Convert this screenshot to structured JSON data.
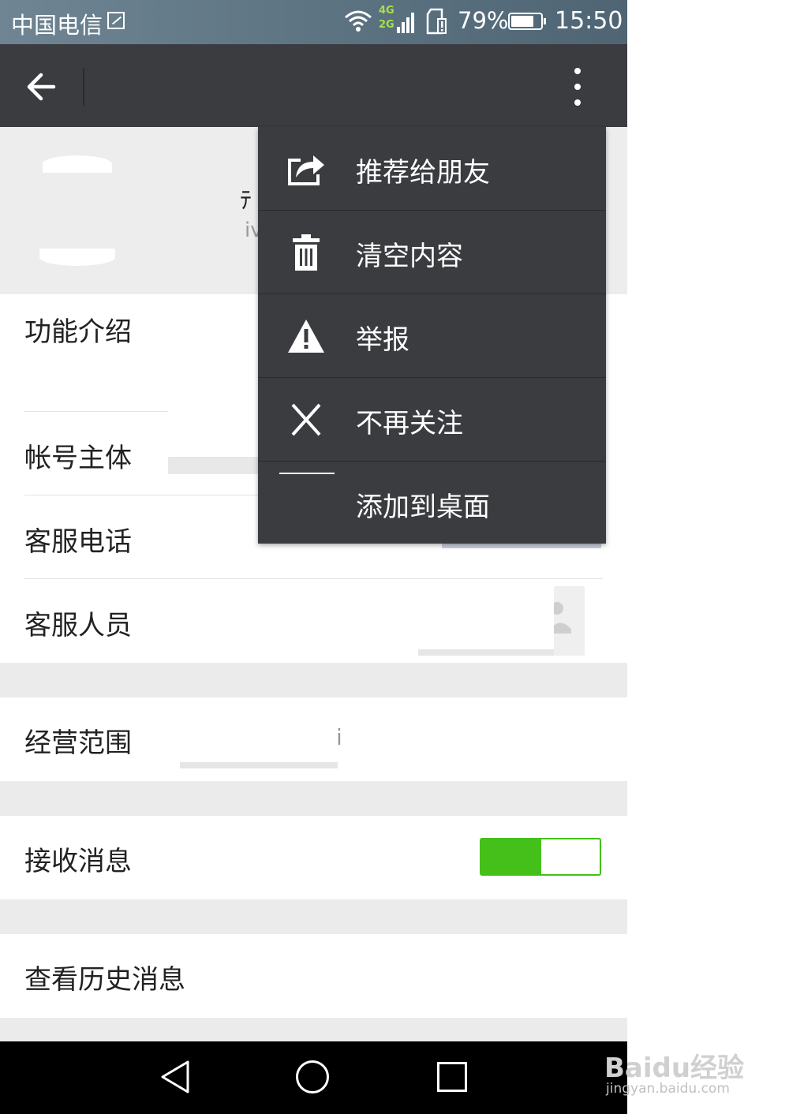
{
  "status_bar": {
    "carrier": "中国电信",
    "net_4g": "4G",
    "net_2g": "2G",
    "battery_percent": "79%",
    "battery_level": 0.79,
    "time": "15:50"
  },
  "header": {
    "name_fragment": "ﾃ",
    "sub_fragment": "iv"
  },
  "menu": {
    "items": [
      {
        "label": "推荐给朋友",
        "icon": "share-icon"
      },
      {
        "label": "清空内容",
        "icon": "trash-icon"
      },
      {
        "label": "举报",
        "icon": "warning-icon"
      },
      {
        "label": "不再关注",
        "icon": "close-icon"
      },
      {
        "label": "添加到桌面",
        "icon": "shortcut-icon"
      }
    ]
  },
  "info": {
    "feature_label": "功能介绍",
    "account_label": "帐号主体",
    "phone_label": "客服电话",
    "staff_label": "客服人员",
    "scope_label": "经营范围",
    "scope_value_fragment": "i",
    "receive_label": "接收消息",
    "receive_enabled": true,
    "history_label": "查看历史消息"
  },
  "watermark": {
    "main": "Baidu经验",
    "sub": "jingyan.baidu.com"
  },
  "colors": {
    "toggle_on": "#45c01a",
    "action_bar": "#3b3c40"
  }
}
